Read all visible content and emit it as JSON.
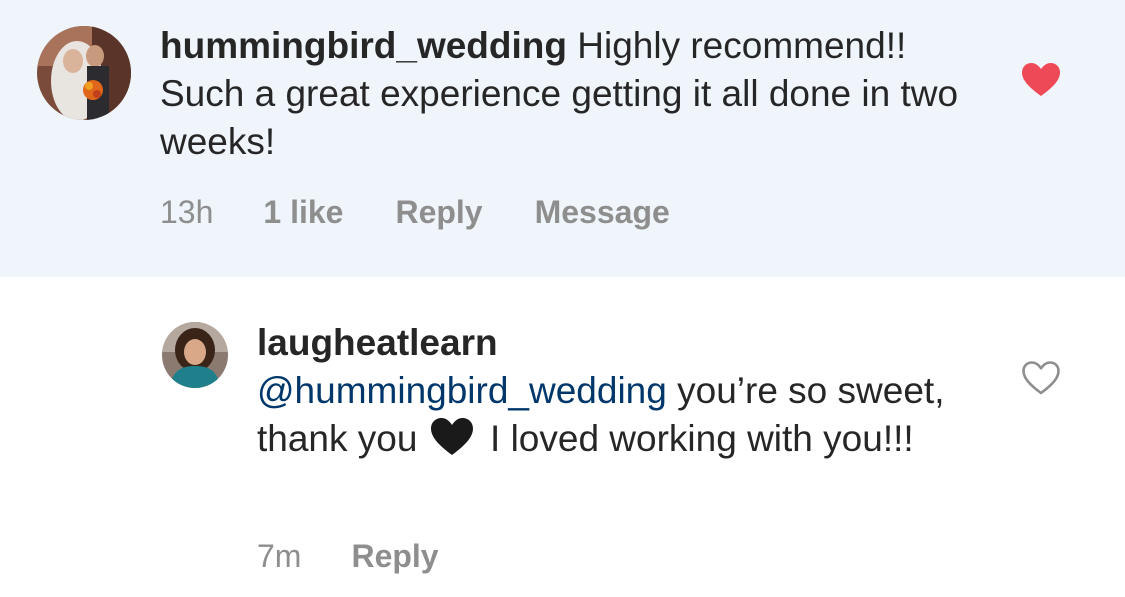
{
  "comments": [
    {
      "username": "hummingbird_wedding",
      "text": " Highly recommend!! Such a great experience getting it all done in two weeks!",
      "time": "13h",
      "likes": "1 like",
      "reply_label": "Reply",
      "message_label": "Message",
      "liked": true,
      "avatar_icon": "wedding-couple-photo"
    }
  ],
  "reply": {
    "username": "laugheatlearn",
    "mention": "@hummingbird_wedding",
    "text_part1": " you’re so sweet, thank you ",
    "emoji": "black-heart",
    "text_part2": " I loved working with you!!!",
    "time": "7m",
    "reply_label": "Reply",
    "liked": false,
    "avatar_icon": "profile-photo"
  },
  "colors": {
    "highlight_bg": "#eff5fb",
    "text": "#262626",
    "meta": "#8e8e8e",
    "mention": "#00376b",
    "liked_heart": "#ed4956"
  }
}
